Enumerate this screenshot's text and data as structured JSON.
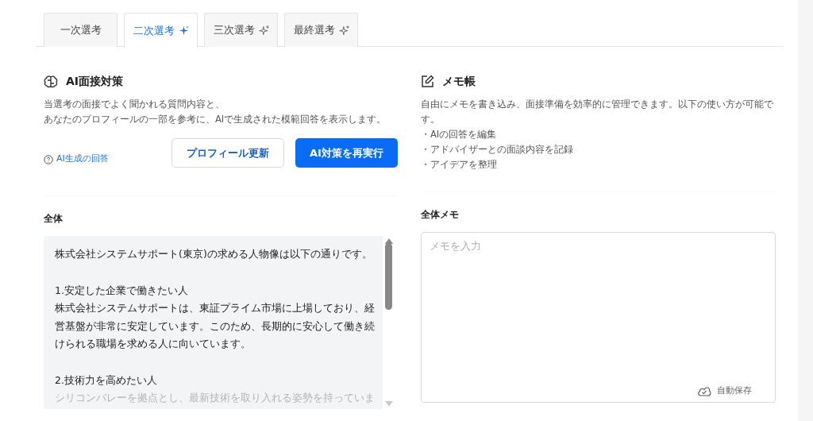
{
  "tabs": [
    {
      "label": "一次選考",
      "selected": false,
      "kind": "plain"
    },
    {
      "label": "二次選考",
      "selected": true,
      "kind": "ai"
    },
    {
      "label": "三次選考",
      "selected": false,
      "kind": "ai"
    },
    {
      "label": "最終選考",
      "selected": false,
      "kind": "ai"
    }
  ],
  "ai_panel": {
    "title": "AI面接対策",
    "description": [
      "当選考の面接でよく聞かれる質問内容と、",
      "あなたのプロフィールの一部を参考に、AIで生成された模範回答を表示します。"
    ],
    "help_link": "AI生成の回答",
    "buttons": [
      {
        "label": "プロフィール更新",
        "kind": "outline"
      },
      {
        "label": "AI対策を再実行",
        "kind": "primary"
      }
    ],
    "section_title": "全体",
    "answer": [
      [
        "株式会社システムサポート(東京)の求める人物像は以下の通りです。"
      ],
      [
        "1.安定した企業で働きたい人",
        "株式会社システムサポートは、東証プライム市場に上場しており、経",
        "営基盤が非常に安定しています。このため、長期的に安心して働き続",
        "けられる職場を求める人に向いています。"
      ],
      [
        "2.技術力を高めたい人",
        "シリコンバレーを拠点とし、最新技術を取り入れる姿勢を持っていま"
      ]
    ]
  },
  "memo_panel": {
    "title": "メモ帳",
    "description": "自由にメモを書き込み、面接準備を効率的に管理できます。以下の使い方が可能です。",
    "uses": [
      "・AIの回答を編集",
      "・アドバイザーとの面談内容を記録",
      "・アイデアを整理"
    ],
    "section_title": "全体メモ",
    "placeholder": "メモを入力",
    "autosave": "自動保存"
  }
}
